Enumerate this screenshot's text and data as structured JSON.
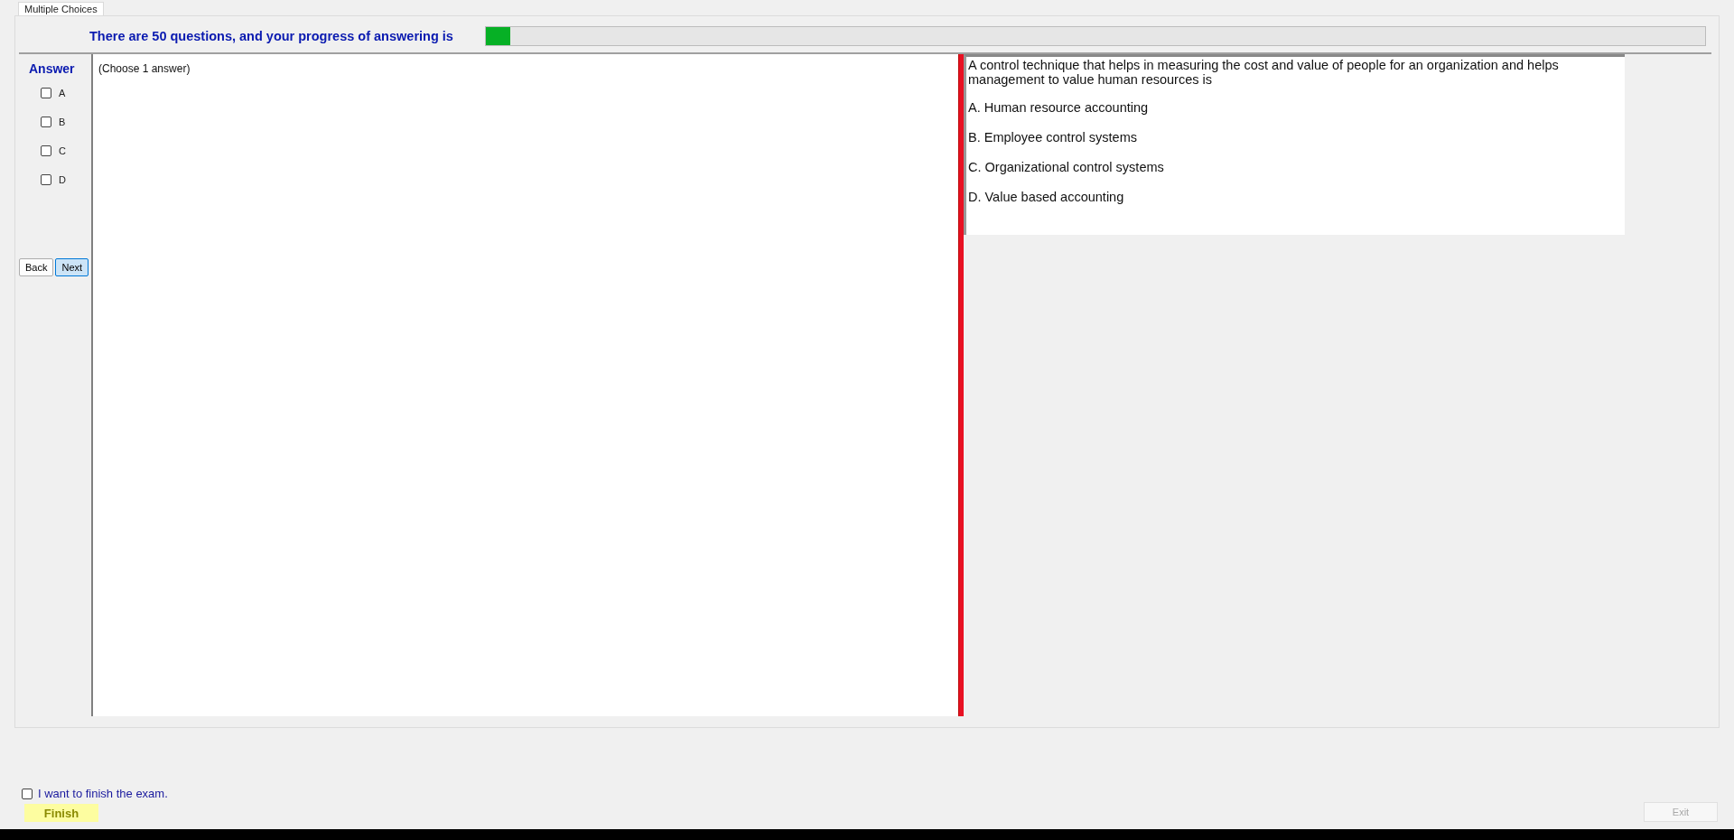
{
  "tab": {
    "label": "Multiple Choices",
    "selected": true
  },
  "header": {
    "text": "There are 50 questions, and your progress of answering is",
    "level": 0.02
  },
  "answer": {
    "label": "Answer",
    "options": [
      {
        "label": "A",
        "checked": false
      },
      {
        "label": "B",
        "checked": false
      },
      {
        "label": "C",
        "checked": false
      },
      {
        "label": "D",
        "checked": false
      }
    ]
  },
  "navigation": [
    {
      "label": "Back",
      "selected": false
    },
    {
      "label": "Next",
      "selected": true
    }
  ],
  "instruction": "(Choose 1 answer)",
  "question": {
    "text": "A control technique that helps in measuring the cost and value of people for an organization and helps management to value human resources is",
    "choices": [
      "A.  Human resource accounting",
      "B.  Employee control systems",
      "C.  Organizational control systems",
      "D.  Value based accounting"
    ]
  },
  "finish": {
    "confirm_label": "I want to finish the exam.",
    "checked": false,
    "button": "Finish"
  },
  "exit_button": {
    "label": "Exit",
    "disabled": true
  }
}
